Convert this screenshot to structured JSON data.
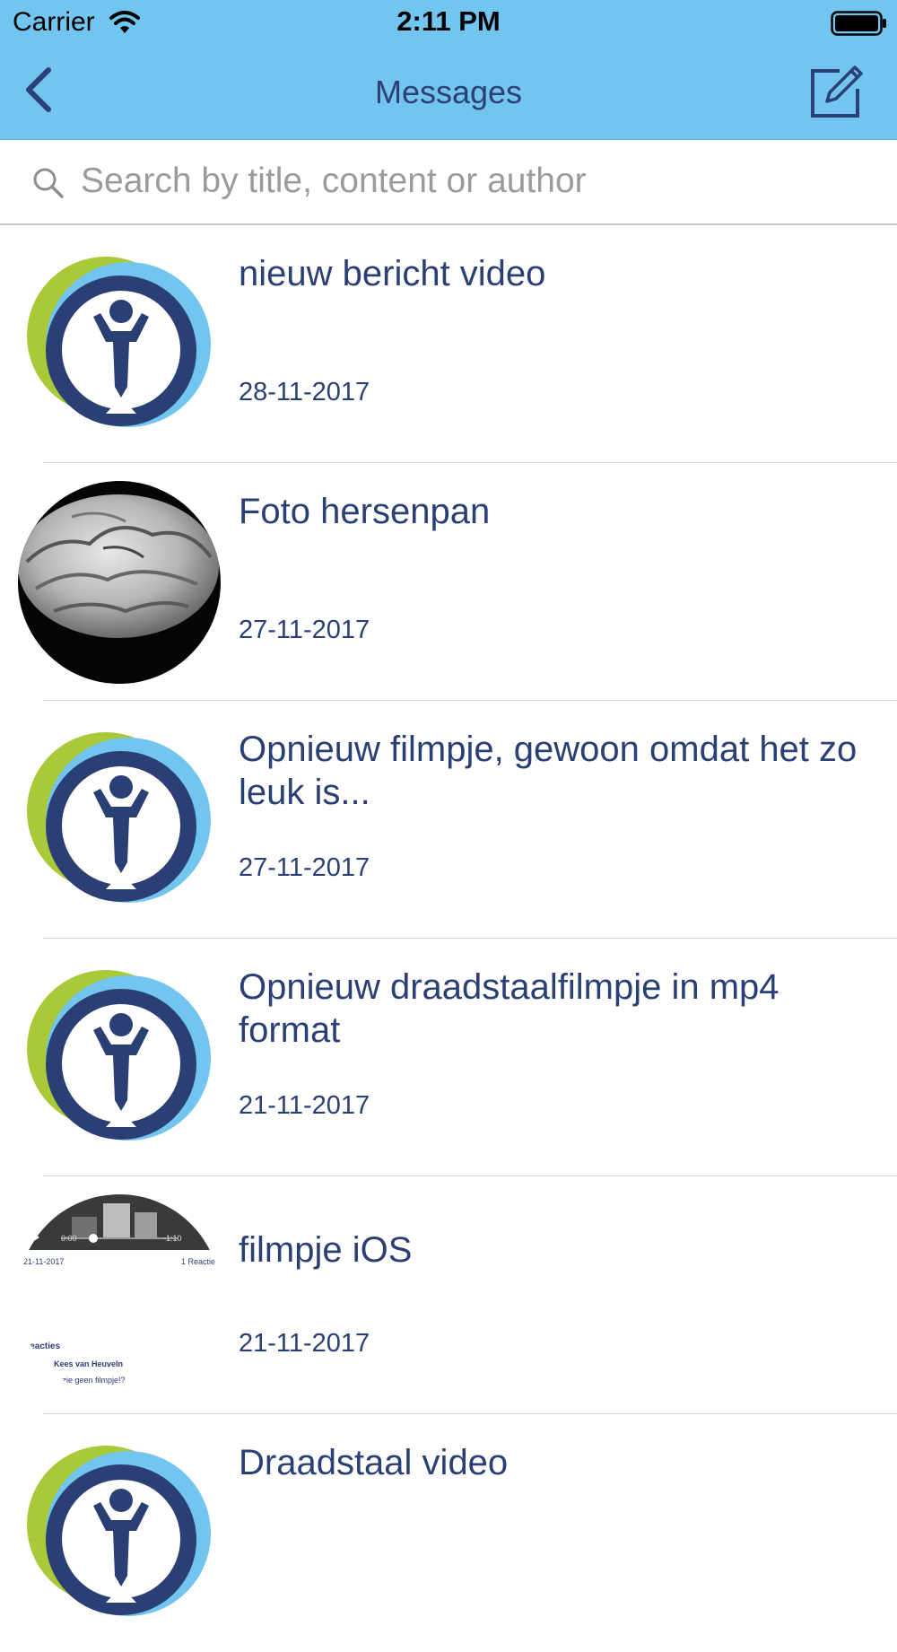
{
  "status_bar": {
    "carrier": "Carrier",
    "time": "2:11 PM"
  },
  "nav": {
    "title": "Messages",
    "back_icon": "chevron-left-icon",
    "compose_icon": "compose-icon"
  },
  "search": {
    "placeholder": "Search by title, content or author",
    "value": ""
  },
  "colors": {
    "header": "#72c5ef",
    "navy": "#2a3f73",
    "green": "#a9c938",
    "light_blue": "#72c5ef"
  },
  "messages": [
    {
      "title": "nieuw bericht video",
      "date": "28-11-2017",
      "avatar": "logo"
    },
    {
      "title": "Foto hersenpan",
      "date": "27-11-2017",
      "avatar": "photo-hands-brain"
    },
    {
      "title": "Opnieuw filmpje, gewoon omdat het zo leuk is...",
      "date": "27-11-2017",
      "avatar": "logo"
    },
    {
      "title": "Opnieuw draadstaalfilmpje in mp4 format",
      "date": "21-11-2017",
      "avatar": "logo"
    },
    {
      "title": "filmpje iOS",
      "date": "21-11-2017",
      "avatar": "video-screenshot",
      "thumb": {
        "time_start": "0:00",
        "time_end": "-1:10",
        "date": "21-11-2017",
        "reactions": "1 Reactie",
        "reacties_label": "Reacties",
        "commenter": "Kees van Heuveln",
        "comment": "Ik zie geen filmpje!?"
      }
    },
    {
      "title": "Draadstaal video",
      "date": "",
      "avatar": "logo"
    }
  ]
}
